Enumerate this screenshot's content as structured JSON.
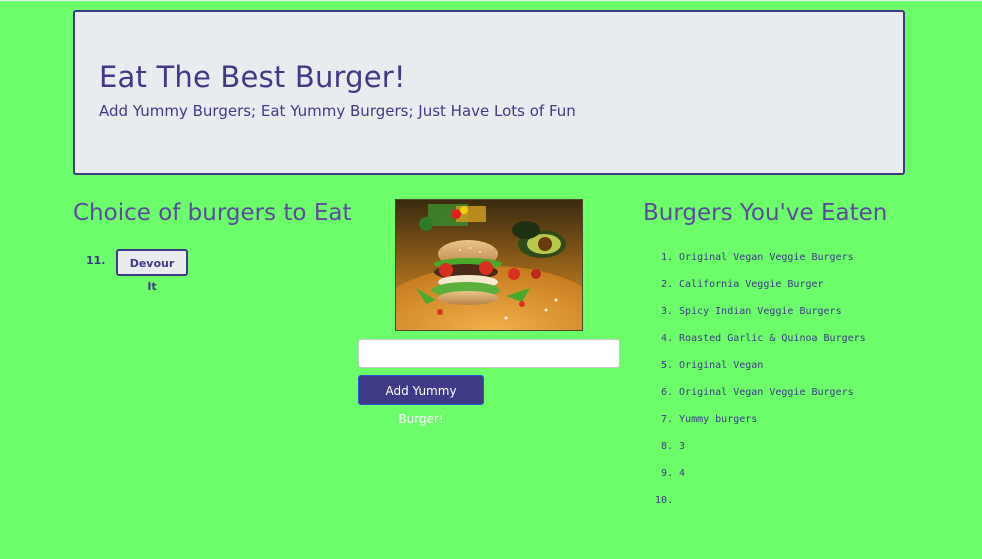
{
  "header": {
    "title": "Eat The Best Burger!",
    "subtitle": "Add Yummy Burgers; Eat Yummy Burgers; Just Have Lots of Fun"
  },
  "left_panel": {
    "heading": "Choice of burgers to Eat",
    "items": [
      {
        "number": "11.",
        "button_label": "Devour It"
      }
    ]
  },
  "center_panel": {
    "image_icon": "burger-photo",
    "input_value": "",
    "input_placeholder": "",
    "add_button_label": "Add Yummy Burger!"
  },
  "right_panel": {
    "heading": "Burgers You've Eaten",
    "items": [
      {
        "number": "1.",
        "label": "Original Vegan Veggie Burgers"
      },
      {
        "number": "2.",
        "label": "California Veggie Burger"
      },
      {
        "number": "3.",
        "label": "Spicy Indian Veggie Burgers"
      },
      {
        "number": "4.",
        "label": "Roasted Garlic & Quinoa Burgers"
      },
      {
        "number": "5.",
        "label": "Original Vegan"
      },
      {
        "number": "6.",
        "label": "Original Vegan Veggie Burgers"
      },
      {
        "number": "7.",
        "label": "Yummy burgers"
      },
      {
        "number": "8.",
        "label": "3"
      },
      {
        "number": "9.",
        "label": "4"
      },
      {
        "number": "10.",
        "label": ""
      }
    ]
  },
  "colors": {
    "background": "#6dfc6a",
    "primary": "#3e3a86",
    "jumbotron_bg": "#e9ecef",
    "heading": "#5b4a9e"
  }
}
